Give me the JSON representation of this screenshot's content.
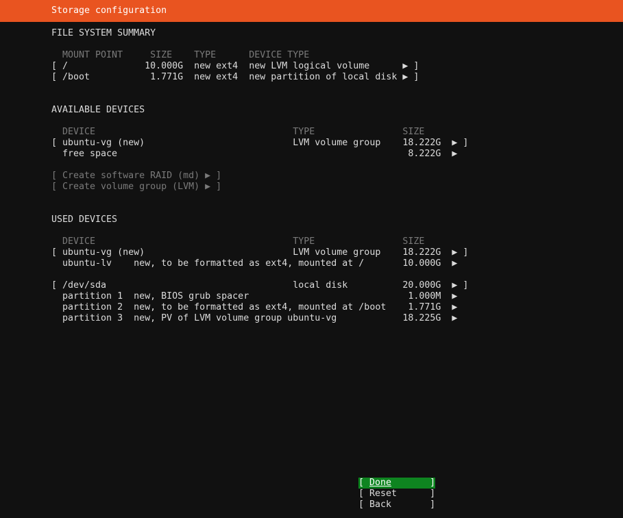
{
  "title": "Storage configuration",
  "summary": {
    "heading": "FILE SYSTEM SUMMARY",
    "columns_line": "  MOUNT POINT     SIZE    TYPE      DEVICE TYPE",
    "rows": [
      "[ /              10.000G  new ext4  new LVM logical volume      ▶ ]",
      "[ /boot           1.771G  new ext4  new partition of local disk ▶ ]"
    ]
  },
  "available": {
    "heading": "AVAILABLE DEVICES",
    "columns_line": "  DEVICE                                    TYPE                SIZE",
    "rows": [
      "[ ubuntu-vg (new)                           LVM volume group    18.222G  ▶ ]",
      "  free space                                                     8.222G  ▶"
    ],
    "actions": [
      "[ Create software RAID (md) ▶ ]",
      "[ Create volume group (LVM) ▶ ]"
    ]
  },
  "used": {
    "heading": "USED DEVICES",
    "columns_line": "  DEVICE                                    TYPE                SIZE",
    "vg_rows": [
      "[ ubuntu-vg (new)                           LVM volume group    18.222G  ▶ ]",
      "  ubuntu-lv    new, to be formatted as ext4, mounted at /       10.000G  ▶"
    ],
    "disk_rows": [
      "[ /dev/sda                                  local disk          20.000G  ▶ ]",
      "  partition 1  new, BIOS grub spacer                             1.000M  ▶",
      "  partition 2  new, to be formatted as ext4, mounted at /boot    1.771G  ▶",
      "  partition 3  new, PV of LVM volume group ubuntu-vg            18.225G  ▶"
    ]
  },
  "buttons": {
    "done_open": "[ ",
    "done_label": "Done",
    "done_close": "       ]",
    "reset": "[ Reset      ]",
    "back": "[ Back       ]"
  },
  "colors": {
    "accent": "#e95420",
    "selected": "#0e8420",
    "background": "#111111"
  }
}
